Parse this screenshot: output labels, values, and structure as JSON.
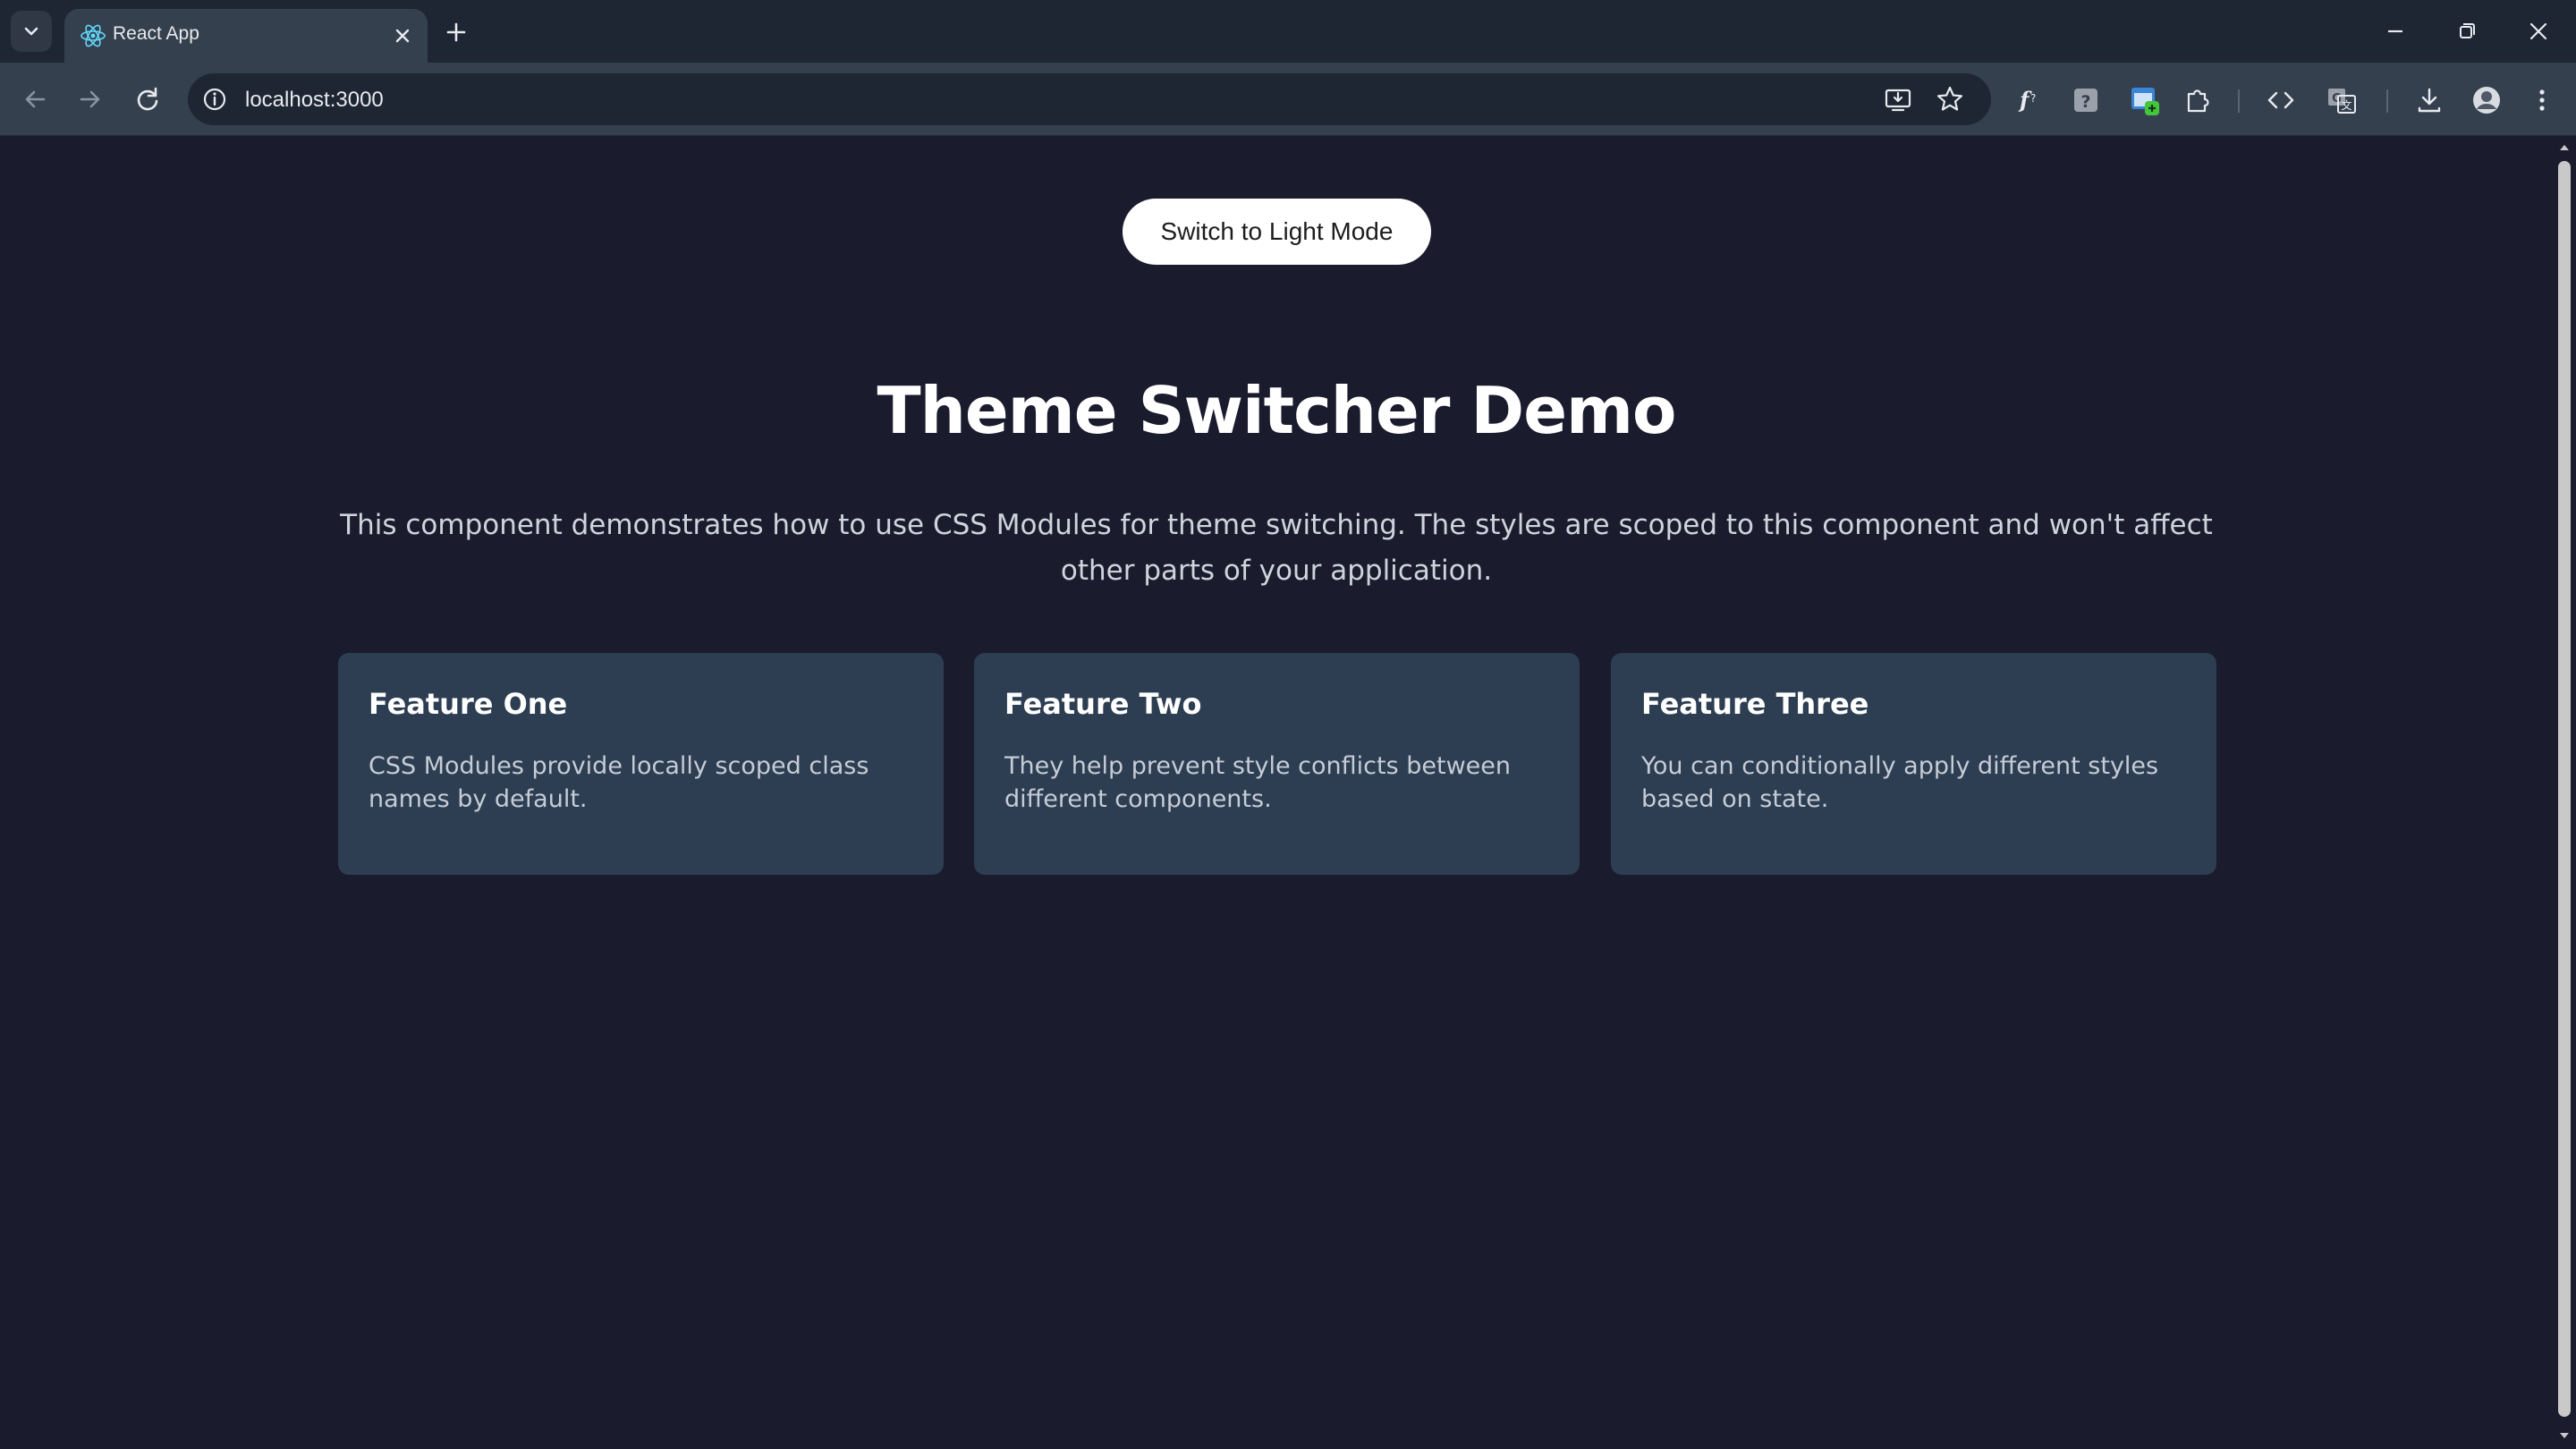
{
  "browser": {
    "tab": {
      "title": "React App"
    },
    "address_bar": {
      "url": "localhost:3000"
    }
  },
  "page": {
    "toggle_button": {
      "label": "Switch to Light Mode"
    },
    "title": "Theme Switcher Demo",
    "description": "This component demonstrates how to use CSS Modules for theme switching. The styles are scoped to this component and won't affect other parts of your application.",
    "cards": [
      {
        "title": "Feature One",
        "text": "CSS Modules provide locally scoped class names by default."
      },
      {
        "title": "Feature Two",
        "text": "They help prevent style conflicts between different components."
      },
      {
        "title": "Feature Three",
        "text": "You can conditionally apply different styles based on state."
      }
    ]
  },
  "colors": {
    "page_background": "#1b1b2e",
    "card_background": "#2d3e52",
    "button_background": "#ffffff",
    "title_text": "#ffffff",
    "body_text": "#cfd4dc"
  },
  "icons": {
    "tabbar": [
      "tab-search-icon",
      "react-favicon-icon",
      "close-icon",
      "plus-icon",
      "minimize-icon",
      "restore-icon",
      "window-close-icon"
    ],
    "toolbar": [
      "back-arrow-icon",
      "forward-arrow-icon",
      "reload-icon",
      "info-icon",
      "install-app-icon",
      "star-icon",
      "font-extension-icon",
      "help-extension-icon",
      "window-extension-icon",
      "puzzle-icon",
      "code-icon",
      "translate-icon",
      "download-icon",
      "profile-avatar-icon",
      "kebab-menu-icon"
    ]
  }
}
